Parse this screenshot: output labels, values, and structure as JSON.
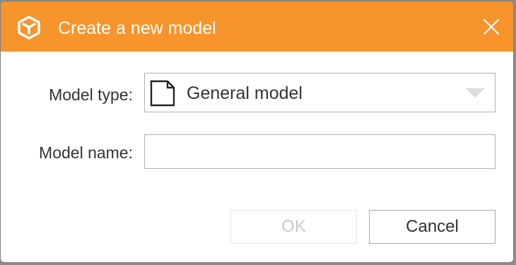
{
  "dialog": {
    "title": "Create a new model",
    "icon": "model-cube-icon",
    "close_icon": "close-icon",
    "accent_color": "#f7942b"
  },
  "form": {
    "model_type_label": "Model type:",
    "model_type_value": "General model",
    "model_type_icon": "document-icon",
    "model_name_label": "Model name:",
    "model_name_value": "",
    "model_name_placeholder": ""
  },
  "buttons": {
    "ok_label": "OK",
    "ok_enabled": false,
    "cancel_label": "Cancel"
  }
}
